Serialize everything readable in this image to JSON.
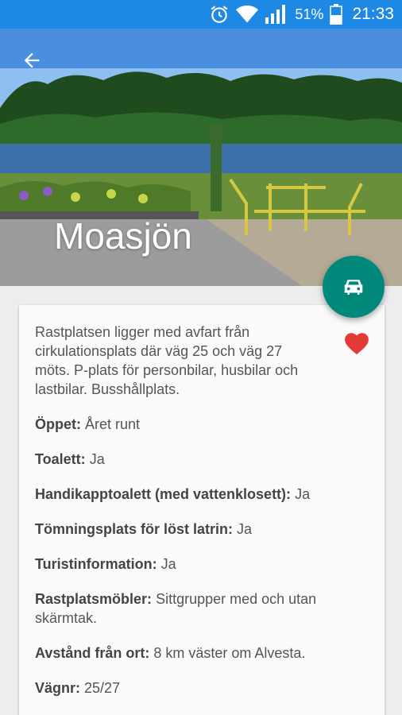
{
  "status_bar": {
    "battery_percent": "51%",
    "time": "21:33",
    "icons": [
      "alarm-icon",
      "wifi-icon",
      "signal-icon",
      "battery-icon"
    ]
  },
  "header": {
    "title": "Moasjön",
    "back_icon": "arrow-back-icon"
  },
  "fab": {
    "icon": "car-icon",
    "color": "#00897b"
  },
  "favorite": {
    "icon": "heart-icon",
    "color": "#e53935"
  },
  "colors": {
    "status_bar": "#1e88e5",
    "background": "#ededed",
    "card": "#fafafa"
  },
  "description": "Rastplatsen ligger med avfart från cirkulationsplats där väg 25 och väg 27 möts. P-plats för personbilar, husbilar och lastbilar. Busshållplats.",
  "fields": [
    {
      "label": "Öppet:",
      "value": "Året runt"
    },
    {
      "label": "Toalett:",
      "value": "Ja"
    },
    {
      "label": "Handikapptoalett (med vattenklosett):",
      "value": "Ja"
    },
    {
      "label": "Tömningsplats för löst latrin:",
      "value": "Ja"
    },
    {
      "label": "Turistinformation:",
      "value": "Ja"
    },
    {
      "label": "Rastplatsmöbler:",
      "value": "Sittgrupper med och utan skärmtak."
    },
    {
      "label": "Avstånd från ort:",
      "value": "8 km väster om Alvesta."
    },
    {
      "label": "Vägnr:",
      "value": "25/27"
    }
  ]
}
